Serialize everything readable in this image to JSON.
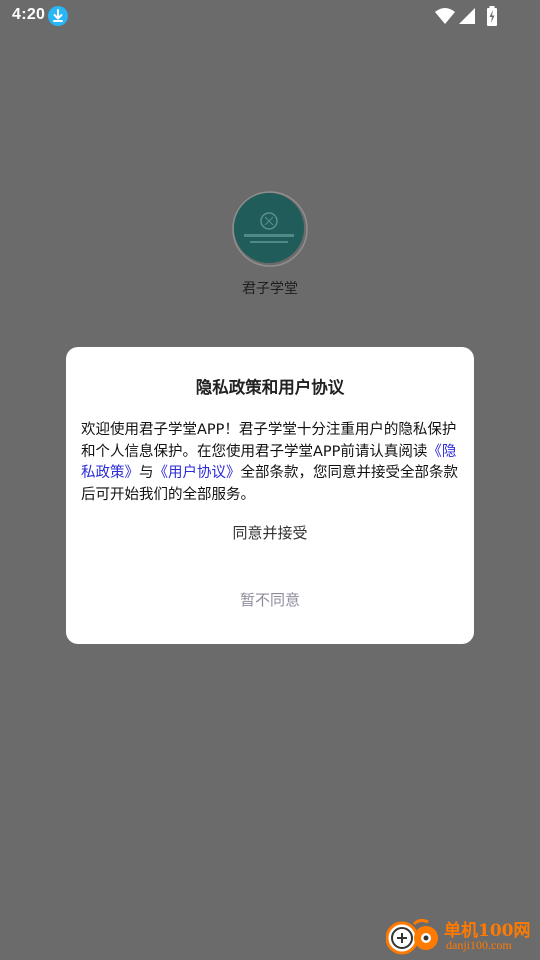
{
  "status_bar": {
    "time": "4:20",
    "icons": [
      "download-icon",
      "wifi-icon",
      "signal-icon",
      "battery-charging-icon"
    ]
  },
  "app": {
    "name": "君子学堂"
  },
  "dialog": {
    "title": "隐私政策和用户协议",
    "body_intro": "欢迎使用君子学堂APP！君子学堂十分注重用户的隐私保护和个人信息保护。在您使用君子学堂APP前请认真阅读",
    "privacy_link": "《隐私政策》",
    "connector": "与",
    "terms_link": "《用户协议》",
    "body_outro": "全部条款，您同意并接受全部条款后可开始我们的全部服务。",
    "agree_label": "同意并接受",
    "disagree_label": "暂不同意"
  },
  "watermark": {
    "cn": "单机100网",
    "en": "danji100.com"
  },
  "colors": {
    "overlay": "#6b6b6b",
    "link": "#2b2bd8",
    "disagree_text": "#8c8c9c",
    "watermark": "#ff7a00",
    "logo_bg": "#1f5c5a"
  }
}
